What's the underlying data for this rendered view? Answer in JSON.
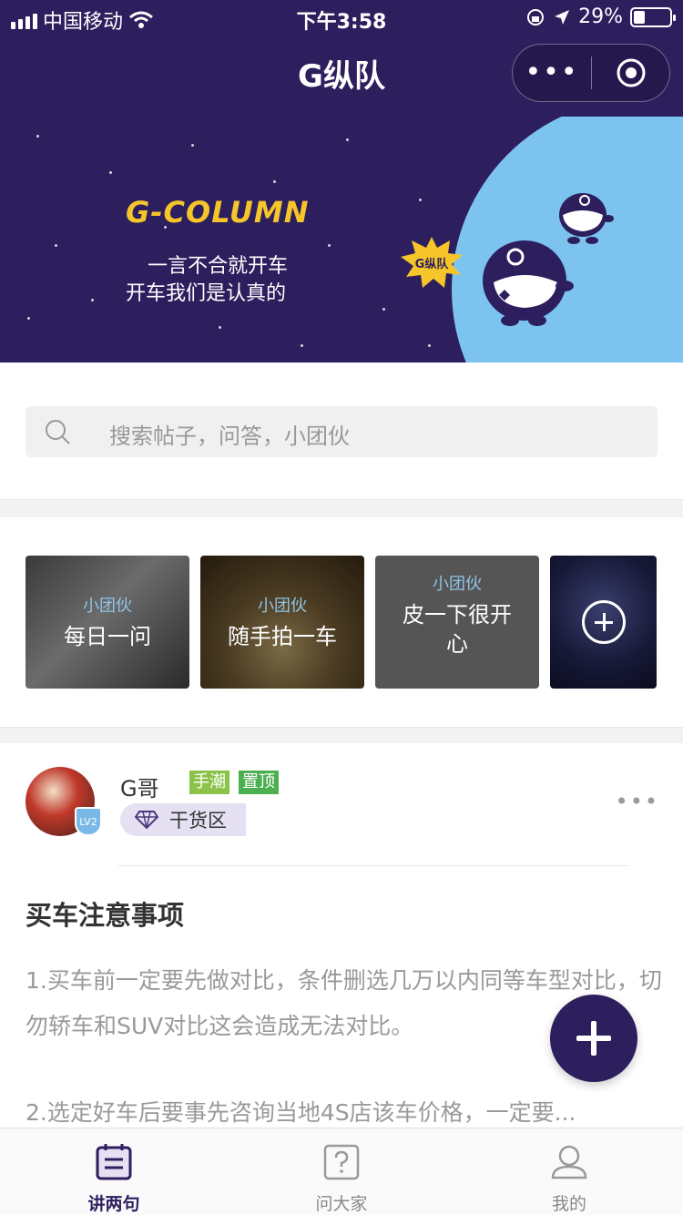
{
  "status_bar": {
    "carrier": "中国移动",
    "time": "下午3:58",
    "battery": "29%"
  },
  "nav": {
    "title": "G纵队",
    "menu_glyph": "•••"
  },
  "banner": {
    "title": "G-COLUMN",
    "line1": "一言不合就开车",
    "line2": "开车我们是认真的",
    "badge": "G纵队"
  },
  "search": {
    "placeholder": "搜索帖子，问答，小团伙"
  },
  "groups": [
    {
      "tag": "小团伙",
      "name": "每日一问"
    },
    {
      "tag": "小团伙",
      "name": "随手拍一车"
    },
    {
      "tag": "小团伙",
      "name": "皮一下很开心"
    }
  ],
  "post": {
    "author": "G哥",
    "level": "LV2",
    "badges": [
      "手潮",
      "置顶"
    ],
    "zone": "干货区",
    "title": "买车注意事项",
    "body1": "1.买车前一定要先做对比，条件删选几万以内同等车型对比，切勿轿车和SUV对比这会造成无法对比。",
    "body2": "2.选定好车后要事先咨询当地4S店该车价格，一定要..."
  },
  "tabs": [
    {
      "label": "讲两句",
      "icon": "chat-list-icon",
      "active": true
    },
    {
      "label": "问大家",
      "icon": "question-icon",
      "active": false
    },
    {
      "label": "我的",
      "icon": "user-icon",
      "active": false
    }
  ],
  "colors": {
    "brand": "#2d1e5e",
    "banner_blue": "#7cc3f0",
    "banner_title": "#f5c52a"
  }
}
